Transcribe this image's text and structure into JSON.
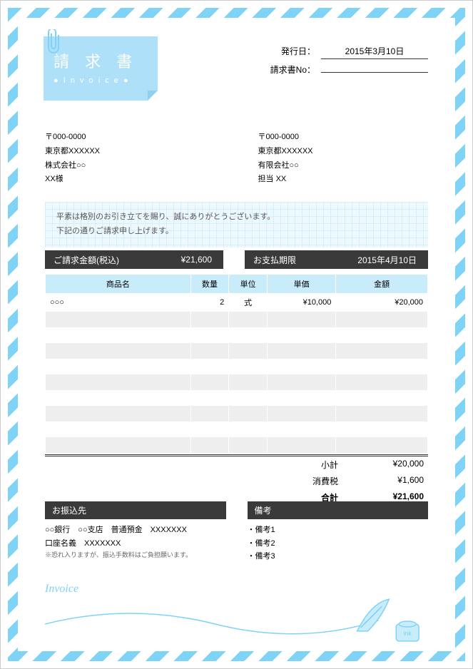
{
  "title": {
    "main": "請 求 書",
    "sub": "● I n v o i c e ●"
  },
  "header": {
    "issue_label": "発行日：",
    "issue_date": "2015年3月10日",
    "no_label": "請求書No：",
    "no_value": ""
  },
  "recipient": {
    "postal": "〒000-0000",
    "address": "東京都XXXXXX",
    "company": "株式会社○○",
    "attn": "XX様"
  },
  "sender": {
    "postal": "〒000-0000",
    "address": "東京都XXXXXX",
    "company": "有限会社○○",
    "person_label": "担当",
    "person": "XX"
  },
  "greeting": {
    "line1": "平素は格別のお引き立てを賜り、誠にありがとうございます。",
    "line2": "下記の通りご請求申し上げます。"
  },
  "summary": {
    "amount_label": "ご請求金額(税込)",
    "amount": "¥21,600",
    "due_label": "お支払期限",
    "due": "2015年4月10日"
  },
  "table": {
    "headers": {
      "name": "商品名",
      "qty": "数量",
      "unit": "単位",
      "price": "単価",
      "amount": "金額"
    },
    "rows": [
      {
        "name": "○○○",
        "qty": "2",
        "unit": "式",
        "price": "¥10,000",
        "amount": "¥20,000"
      },
      {
        "name": "",
        "qty": "",
        "unit": "",
        "price": "",
        "amount": ""
      },
      {
        "name": "",
        "qty": "",
        "unit": "",
        "price": "",
        "amount": ""
      },
      {
        "name": "",
        "qty": "",
        "unit": "",
        "price": "",
        "amount": ""
      },
      {
        "name": "",
        "qty": "",
        "unit": "",
        "price": "",
        "amount": ""
      },
      {
        "name": "",
        "qty": "",
        "unit": "",
        "price": "",
        "amount": ""
      },
      {
        "name": "",
        "qty": "",
        "unit": "",
        "price": "",
        "amount": ""
      },
      {
        "name": "",
        "qty": "",
        "unit": "",
        "price": "",
        "amount": ""
      },
      {
        "name": "",
        "qty": "",
        "unit": "",
        "price": "",
        "amount": ""
      },
      {
        "name": "",
        "qty": "",
        "unit": "",
        "price": "",
        "amount": ""
      }
    ]
  },
  "totals": {
    "subtotal_label": "小計",
    "subtotal": "¥20,000",
    "tax_label": "消費税",
    "tax": "¥1,600",
    "total_label": "合計",
    "total": "¥21,600"
  },
  "bank": {
    "heading": "お振込先",
    "line1": "○○銀行　○○支店　普通預金　XXXXXXX",
    "line2": "口座名義　XXXXXXX",
    "note": "※恐れ入りますが、振込手数料はご負担願います。"
  },
  "remarks": {
    "heading": "備考",
    "items": [
      "・備考1",
      "・備考2",
      "・備考3"
    ]
  },
  "footer_script": "Invoice"
}
